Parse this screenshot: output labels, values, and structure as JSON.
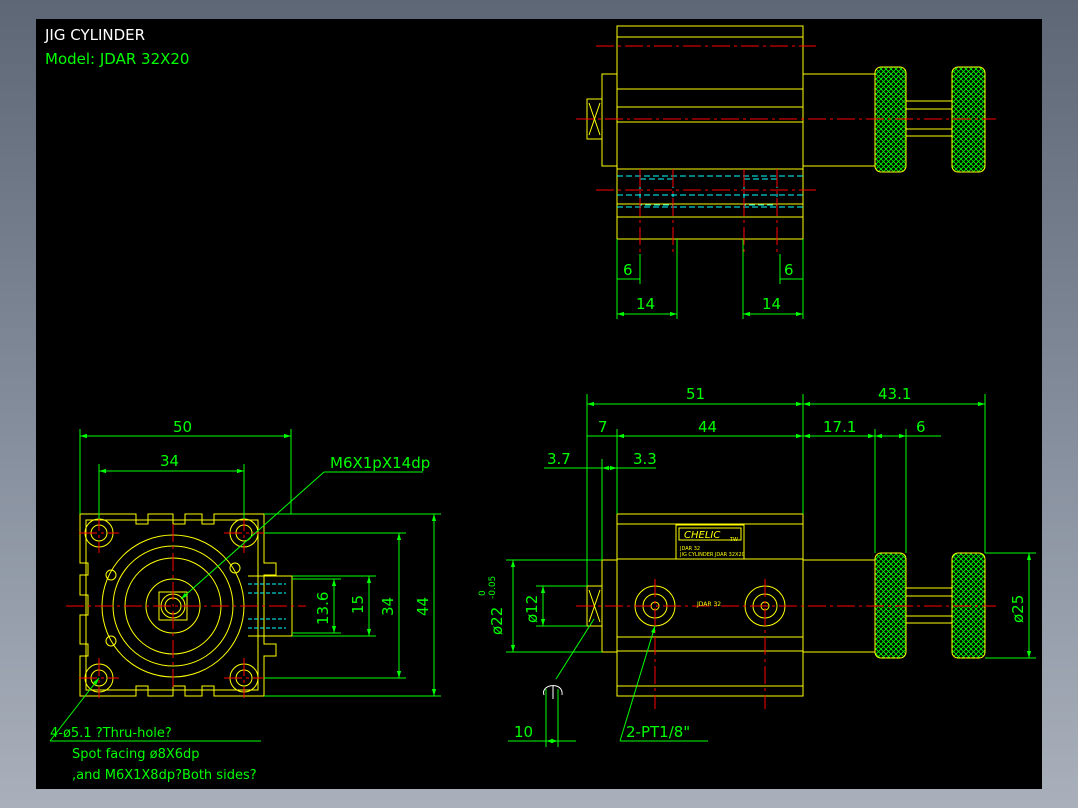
{
  "title_block": {
    "title": "JIG CYLINDER",
    "model": "Model:  JDAR  32X20"
  },
  "top_view_dims": {
    "left_small": "6",
    "right_small": "6",
    "left_wide": "14",
    "right_wide": "14"
  },
  "front_view_dims": {
    "width": "50",
    "inner_width": "34",
    "thread_note": "M6X1pX14dp",
    "h_13_6": "13.6",
    "h_15": "15",
    "h_34": "34",
    "h_44": "44"
  },
  "side_view_dims": {
    "total_51": "51",
    "rod_43_1": "43.1",
    "d_7": "7",
    "d_44": "44",
    "d_17_1": "17.1",
    "d_6": "6",
    "d_3_7": "3.7",
    "d_3_3": "3.3",
    "dia_22": "ø22",
    "tol_upper": "0",
    "tol_lower": "-0.05",
    "dia_12": "ø12",
    "dia_25": "ø25",
    "d_10": "10",
    "port_note": "2-PT1/8\"",
    "brand": "CHELIC",
    "brand_tag": "TW",
    "plate_line1": "JDAR 32",
    "plate_line2": "JIG CYLINDER  JDAR 32X20",
    "body_mark": "JDAR  32"
  },
  "hole_note": {
    "line1": "4-ø5.1 ?Thru-hole?",
    "line2": "Spot facing  ø8X6dp",
    "line3": ",and M6X1X8dp?Both sides?"
  },
  "colors": {
    "background": "#000000",
    "outline": "#ffff00",
    "dimension": "#00ff00",
    "centerline": "#ff0000",
    "hidden": "#00ffff",
    "text": "#ffffff"
  }
}
